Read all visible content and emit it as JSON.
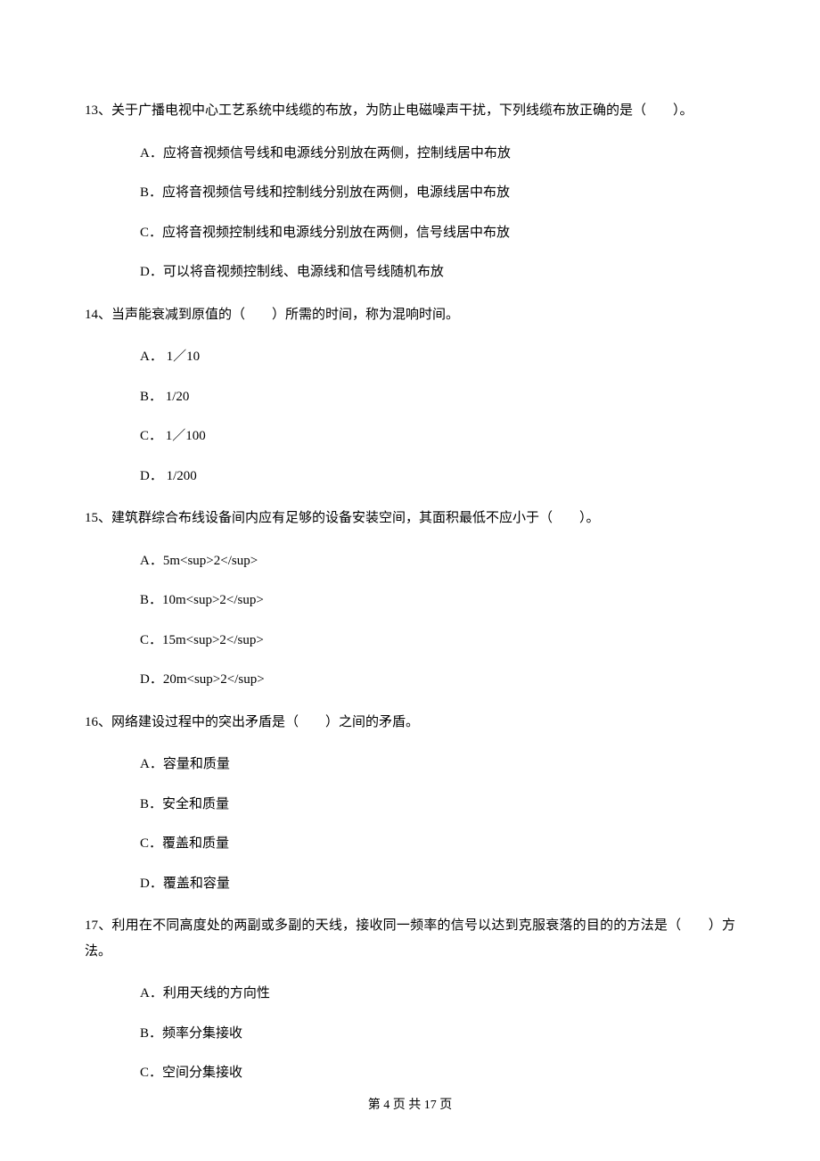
{
  "questions": [
    {
      "number": "13",
      "text": "13、关于广播电视中心工艺系统中线缆的布放，为防止电磁噪声干扰，下列线缆布放正确的是（　　）。",
      "options": [
        "A．应将音视频信号线和电源线分别放在两侧，控制线居中布放",
        "B．应将音视频信号线和控制线分别放在两侧，电源线居中布放",
        "C．应将音视频控制线和电源线分别放在两侧，信号线居中布放",
        "D．可以将音视频控制线、电源线和信号线随机布放"
      ]
    },
    {
      "number": "14",
      "text": "14、当声能衰减到原值的（　　）所需的时间，称为混响时间。",
      "options": [
        "A． 1／10",
        "B． 1/20",
        "C． 1／100",
        "D． 1/200"
      ]
    },
    {
      "number": "15",
      "text": "15、建筑群综合布线设备间内应有足够的设备安装空间，其面积最低不应小于（　　）。",
      "options": [
        "A．5m<sup>2</sup>",
        "B．10m<sup>2</sup>",
        "C．15m<sup>2</sup>",
        "D．20m<sup>2</sup>"
      ]
    },
    {
      "number": "16",
      "text": "16、网络建设过程中的突出矛盾是（　　）之间的矛盾。",
      "options": [
        "A．容量和质量",
        "B．安全和质量",
        "C．覆盖和质量",
        "D．覆盖和容量"
      ]
    },
    {
      "number": "17",
      "text": "17、利用在不同高度处的两副或多副的天线，接收同一频率的信号以达到克服衰落的目的的方法是（　　）方法。",
      "options": [
        "A．利用天线的方向性",
        "B．频率分集接收",
        "C．空间分集接收"
      ]
    }
  ],
  "footer": "第 4 页 共 17 页"
}
